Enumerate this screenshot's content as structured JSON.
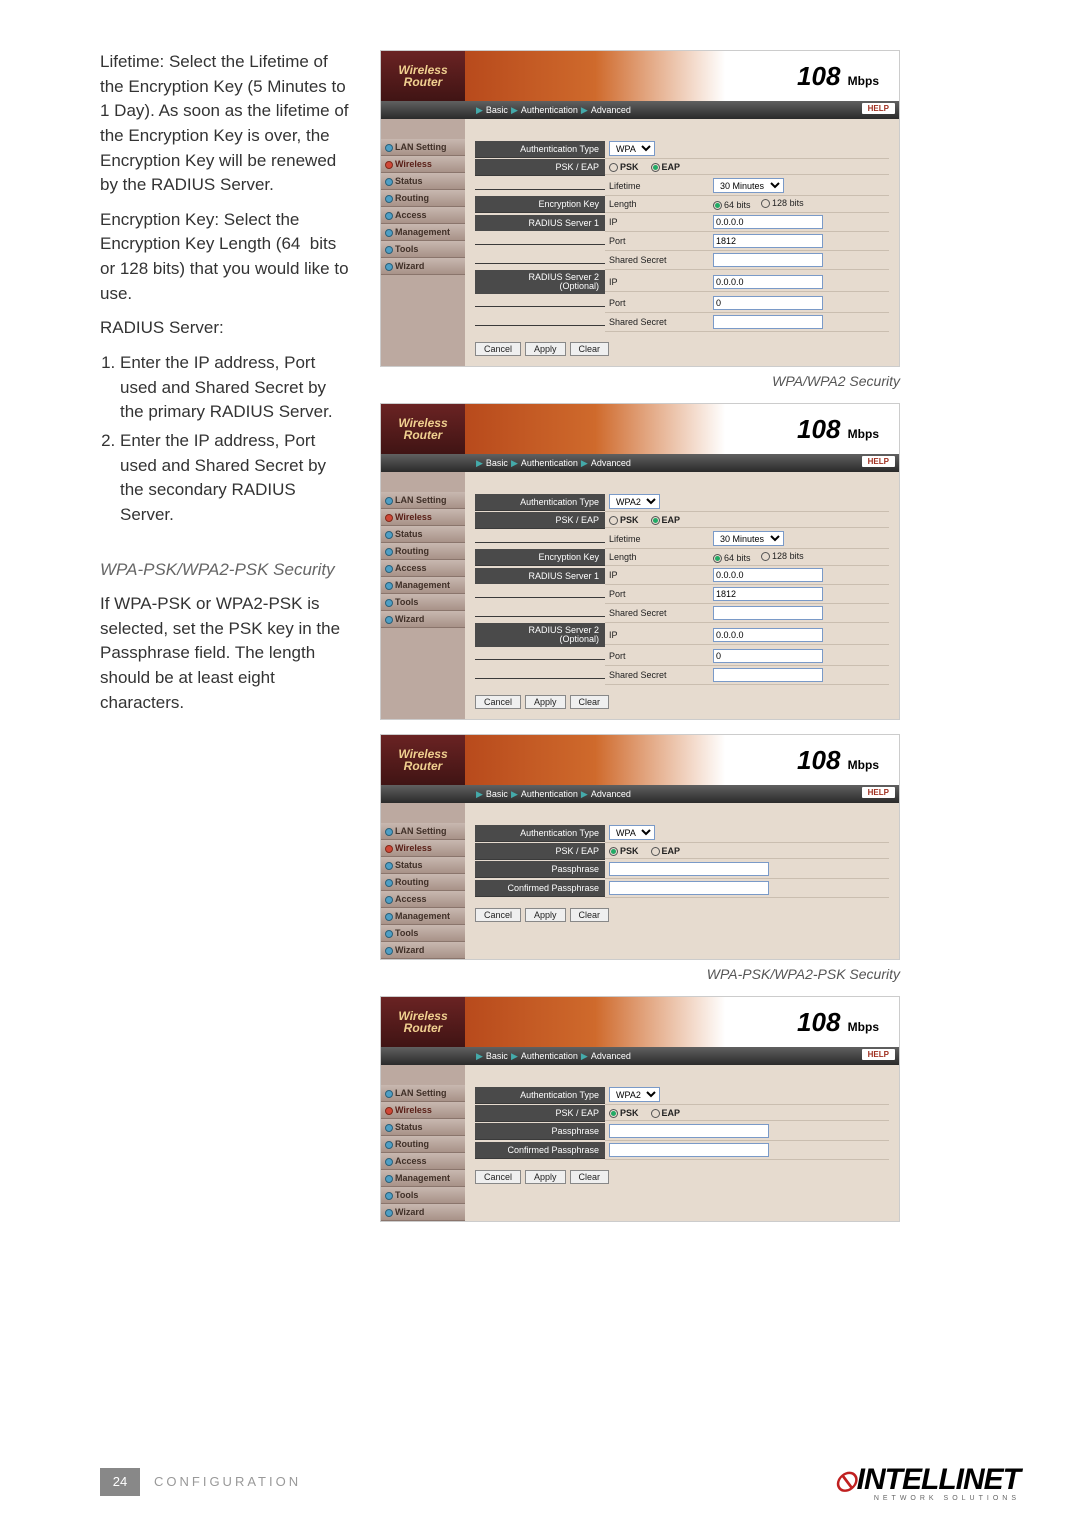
{
  "left": {
    "p1": "Lifetime: Select the Lifetime of the Encryption Key (5 Minutes to 1 Day). As soon as the lifetime of the Encryption Key is over, the Encryption Key will be renewed by the RADIUS Server.",
    "p2": "Encryption Key: Select the Encryption Key Length (64  bits or 128 bits) that you would like to use.",
    "p3": "RADIUS Server:",
    "li1": "Enter the IP address, Port used and Shared Secret by the primary RADIUS Server.",
    "li2": "Enter the IP address, Port used and Shared Secret by the secondary RADIUS Server.",
    "h2": "WPA-PSK/WPA2-PSK Security",
    "p4": "If WPA-PSK or WPA2-PSK is selected, set the PSK key in the Passphrase field. The length should be at least eight characters."
  },
  "router": {
    "logo_line1": "Wireless",
    "logo_line2": "Router",
    "banner_main": "108",
    "banner_unit": "Mbps",
    "bc_basic": "Basic",
    "bc_auth": "Authentication",
    "bc_adv": "Advanced",
    "help": "HELP",
    "sidebar": {
      "lan": "LAN Setting",
      "wireless": "Wireless",
      "status": "Status",
      "routing": "Routing",
      "access": "Access",
      "mgmt": "Management",
      "tools": "Tools",
      "wizard": "Wizard"
    },
    "labels": {
      "auth_type": "Authentication Type",
      "psk_eap": "PSK / EAP",
      "psk": "PSK",
      "eap": "EAP",
      "lifetime": "Lifetime",
      "enc_key": "Encryption Key",
      "length": "Length",
      "bits64": "64 bits",
      "bits128": "128 bits",
      "radius1": "RADIUS Server 1",
      "radius2": "RADIUS Server 2",
      "optional": "(Optional)",
      "ip": "IP",
      "port": "Port",
      "shared": "Shared Secret",
      "passphrase": "Passphrase",
      "confirmed_passphrase": "Confirmed Passphrase"
    },
    "opts": {
      "wpa": "WPA",
      "wpa2": "WPA2",
      "t30": "30 Minutes"
    },
    "vals": {
      "ip0": "0.0.0.0",
      "port1812": "1812",
      "port0": "0"
    },
    "buttons": {
      "cancel": "Cancel",
      "apply": "Apply",
      "clear": "Clear"
    }
  },
  "captions": {
    "c1": "WPA/WPA2 Security",
    "c2": "WPA-PSK/WPA2-PSK Security"
  },
  "footer": {
    "page": "24",
    "section": "CONFIGURATION",
    "brand": "INTELLINET",
    "brand_sub": "NETWORK SOLUTIONS"
  }
}
